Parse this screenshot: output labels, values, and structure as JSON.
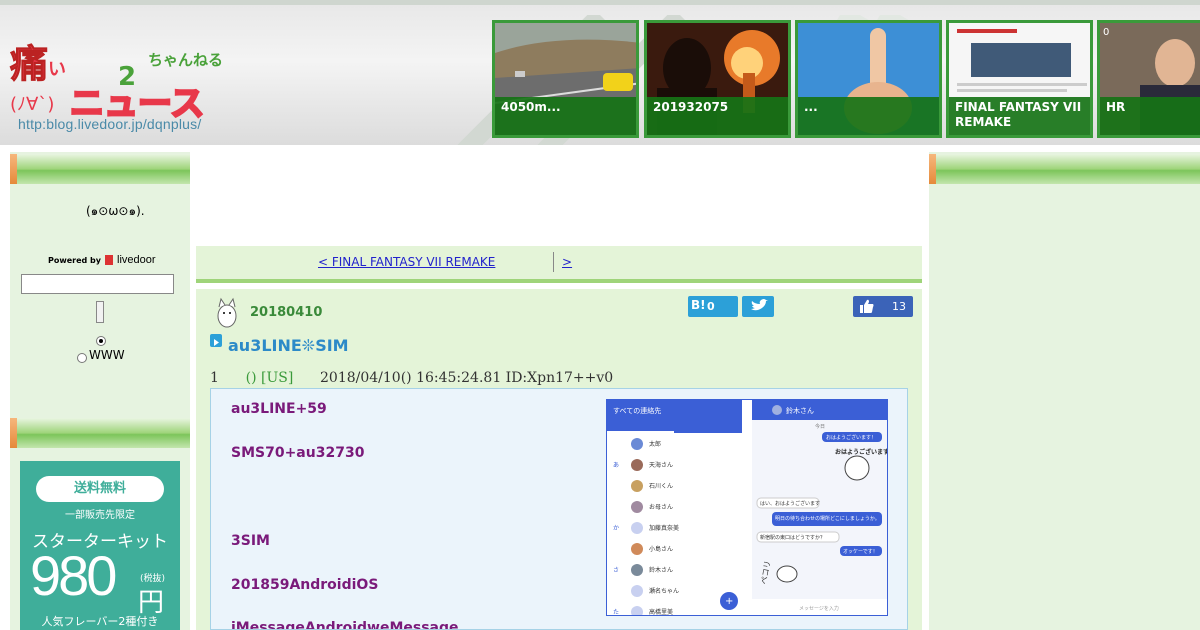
{
  "header": {
    "logo_text": "痛いニュース",
    "logo_sub": "ちゃんねる",
    "logo_face": "(ﾉ∀`)",
    "logo_url": "http:blog.livedoor.jp/dqnplus/",
    "thumbs": [
      {
        "caption": "4050m...",
        "count": ""
      },
      {
        "caption": "201932075",
        "count": ""
      },
      {
        "caption": "...",
        "count": ""
      },
      {
        "caption": "FINAL FANTASY VII REMAKE",
        "count": ""
      },
      {
        "caption": "HR",
        "count": "0"
      }
    ]
  },
  "sidebar": {
    "face": "(๑⊙ω⊙๑).",
    "powered_by": "Powered by",
    "livedoor": "livedoor",
    "search_value": "",
    "radio_www": "WWW"
  },
  "ad": {
    "badge": "送料無料",
    "limited": "一部販売先限定",
    "product": "スターターキット",
    "price": "980",
    "tax": "(税抜)",
    "yen": "円",
    "flavor": "人気フレーバー2種付き",
    "accent_color": "#3fae9a"
  },
  "nav": {
    "prev": "< FINAL FANTASY VII REMAKE",
    "next": ">"
  },
  "article": {
    "date": "20180410",
    "hatena_count": "0",
    "like_count": "13",
    "title": "au3LINE❊SIM",
    "meta_num": "1",
    "meta_name": "() [US]",
    "meta_datetime": "2018/04/10() 16:45:24.81 ID:Xpn17++v0",
    "lines": [
      "au3LINE+59",
      "SMS70+au32730",
      "3SIM",
      "201859AndroidiOS",
      "iMessageAndroidweMessage"
    ]
  },
  "phone": {
    "contacts_header": "すべての連絡先",
    "contacts": [
      "太郎",
      "天海さん",
      "石川くん",
      "お母さん",
      "加藤真奈美",
      "小島さん",
      "鈴木さん",
      "瀬名ちゃん",
      "高橋里美"
    ],
    "index": [
      "あ",
      "か",
      "さ",
      "た"
    ],
    "chat_header": "鈴木さん",
    "chat_today": "今日",
    "msg1": "おはようございます！",
    "sticker_text": "おはようございます",
    "msg2": "はい、おはようございます",
    "msg3": "明日の待ち合わせの場所どこにしましょうか。",
    "msg4": "新宿駅の東口はどうですか？",
    "msg5": "オッケーです！",
    "sticker2": "ペコリ",
    "input_placeholder": "メッセージを入力",
    "accent": "#3b5fd6"
  },
  "colors": {
    "green_bg": "#e6f3e0",
    "title_blue": "#2c8ac8",
    "body_purple": "#7a1a7a",
    "thumb_green": "#2f8a2f"
  }
}
